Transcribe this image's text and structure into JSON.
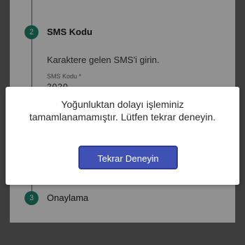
{
  "steps": [
    {
      "number": "2",
      "title": "SMS Kodu"
    },
    {
      "number": "3",
      "title": "Onaylama"
    }
  ],
  "sms_step": {
    "instruction": "Karaktere gelen SMS'i girin.",
    "field_label": "SMS Kodu *",
    "field_value": "2020"
  },
  "dialog": {
    "message": "Yoğunluktan dolayı işleminiz tamamlanamamıştır. Lütfen tekrar deneyin.",
    "button_label": "Tekrar Deneyin"
  },
  "colors": {
    "step_accent": "#1f8a70",
    "button_primary": "#3f51b5"
  }
}
